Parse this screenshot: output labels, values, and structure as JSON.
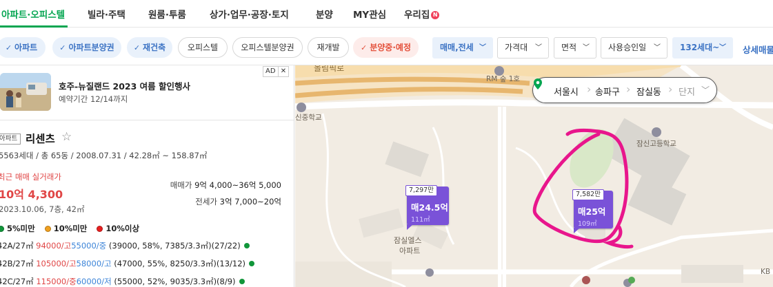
{
  "nav": {
    "items": [
      {
        "label": "아파트·오피스텔",
        "active": true
      },
      {
        "label": "빌라·주택",
        "active": false
      },
      {
        "label": "원룸·투룸",
        "active": false
      },
      {
        "label": "상가·업무·공장·토지",
        "active": false
      },
      {
        "label": "분양",
        "active": false
      },
      {
        "label": "MY관심",
        "active": false
      },
      {
        "label": "우리집",
        "active": false,
        "badge": "N"
      }
    ]
  },
  "filters": {
    "chips": [
      {
        "label": "아파트",
        "state": "selected"
      },
      {
        "label": "아파트분양권",
        "state": "selected"
      },
      {
        "label": "재건축",
        "state": "selected"
      },
      {
        "label": "오피스텔",
        "state": "normal"
      },
      {
        "label": "오피스텔분양권",
        "state": "normal"
      },
      {
        "label": "재개발",
        "state": "normal"
      },
      {
        "label": "분양중·예정",
        "state": "red"
      }
    ],
    "dropdowns": [
      {
        "label": "매매,전세",
        "selected": true
      },
      {
        "label": "가격대",
        "selected": false
      },
      {
        "label": "면적",
        "selected": false
      },
      {
        "label": "사용승인일",
        "selected": false
      },
      {
        "label": "132세대~",
        "selected": true
      }
    ],
    "detail_label": "상세매물"
  },
  "ad": {
    "title": "호주-뉴질랜드 2023 여름 할인행사",
    "subtitle": "예약기간 12/14까지",
    "badge": "AD",
    "close": "✕"
  },
  "complex": {
    "type": "아파트",
    "name": "리센츠",
    "specs": "5563세대 / 총 65동 / 2008.07.31 / 42.28㎡ ~ 158.87㎡",
    "recent_label": "최근 매매 실거래가",
    "recent_price": "10억 4,300",
    "recent_date": "2023.10.06, 7층, 42㎡",
    "sale_range_label": "매매가",
    "sale_range_value": "9억 4,000~36억 5,000",
    "rent_range_label": "전세가",
    "rent_range_value": "3억 7,000~20억"
  },
  "legend": [
    {
      "label": "5%미만",
      "color": "#11963a"
    },
    {
      "label": "10%미만",
      "color": "#f0a020"
    },
    {
      "label": "10%이상",
      "color": "#e82020"
    }
  ],
  "trades": [
    {
      "type": "42A/27㎡",
      "sale": "94000/고",
      "rent": "55000/중",
      "detail": "(39000, 58%, 7385/3.3㎡)(27/22)"
    },
    {
      "type": "42B/27㎡",
      "sale": "105000/고",
      "rent": "58000/고",
      "detail": "(47000, 55%, 8250/3.3㎡)(13/12)"
    },
    {
      "type": "42C/27㎡",
      "sale": "115000/중",
      "rent": "60000/저",
      "detail": "(55000, 52%, 9035/3.3㎡)(8/9)"
    }
  ],
  "map": {
    "breadcrumb": [
      "서울시",
      "송파구",
      "잠실동",
      "단지"
    ],
    "labels": {
      "road": "올림픽로",
      "station": "RM 숲 1호",
      "school1": "신중학교",
      "school2": "잠신고등학교",
      "apt": "잠실엘스",
      "apt2": "아파트",
      "kb": "KB"
    },
    "markers": [
      {
        "price_per": "7,297만",
        "price": "매24.5억",
        "area": "111㎡"
      },
      {
        "price_per": "7,582만",
        "price": "매25억",
        "area": "109㎡"
      }
    ]
  }
}
